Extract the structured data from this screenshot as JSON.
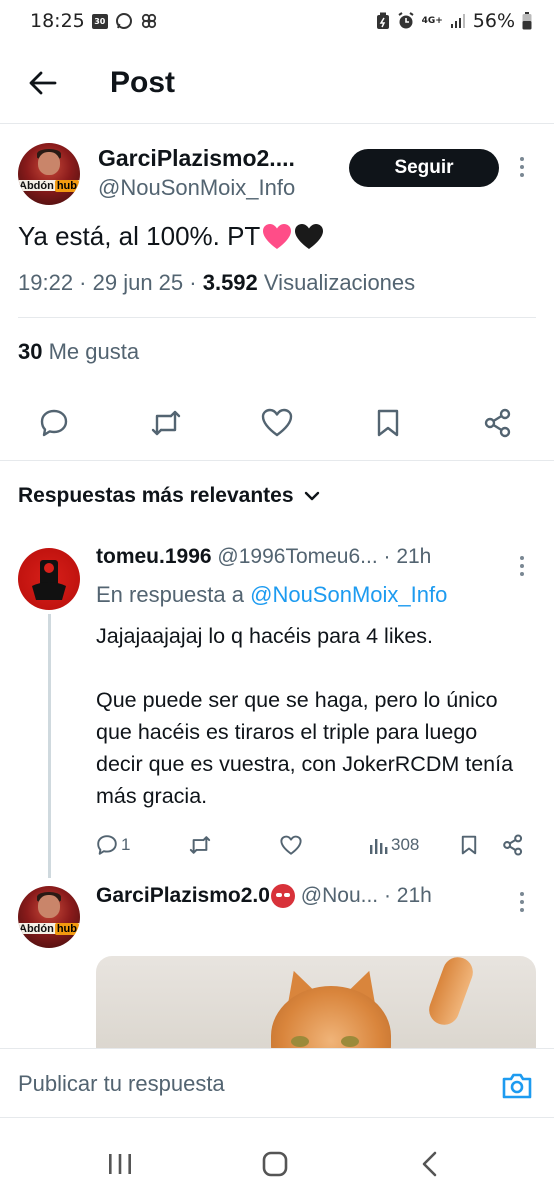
{
  "status_bar": {
    "time": "18:25",
    "calendar_day": "30",
    "network": "4G+",
    "battery": "56%"
  },
  "header": {
    "title": "Post"
  },
  "tweet": {
    "author_name": "GarciPlazismo2....",
    "author_handle": "@NouSonMoix_Info",
    "follow_label": "Seguir",
    "avatar_badge_left": "Abdón",
    "avatar_badge_right": "hub",
    "text": "Ya está, al 100%. PT",
    "time": "19:22",
    "date": "29 jun 25",
    "views_count": "3.592",
    "views_label": "Visualizaciones",
    "likes_count": "30",
    "likes_label": "Me gusta"
  },
  "replies_sort": {
    "label": "Respuestas más relevantes"
  },
  "replies": [
    {
      "name": "tomeu.1996",
      "handle": "@1996Tomeu6...",
      "time": "· 21h",
      "reply_to_prefix": "En respuesta a",
      "reply_to_handle": "@NouSonMoix_Info",
      "text": "Jajajaajajaj lo q hacéis para 4 likes.\n\nQue puede ser que se haga, pero lo único que hacéis es tiraros el triple para luego decir que es vuestra, con JokerRCDM tenía más gracia.",
      "replies_count": "1",
      "views": "308"
    },
    {
      "name": "GarciPlazismo2.0",
      "handle": "@Nou...",
      "time": "· 21h"
    }
  ],
  "compose": {
    "placeholder": "Publicar tu respuesta"
  },
  "colors": {
    "accent": "#1d9bf0",
    "text_primary": "#0f1419",
    "text_secondary": "#536471",
    "follow_button": "#0f1419"
  }
}
